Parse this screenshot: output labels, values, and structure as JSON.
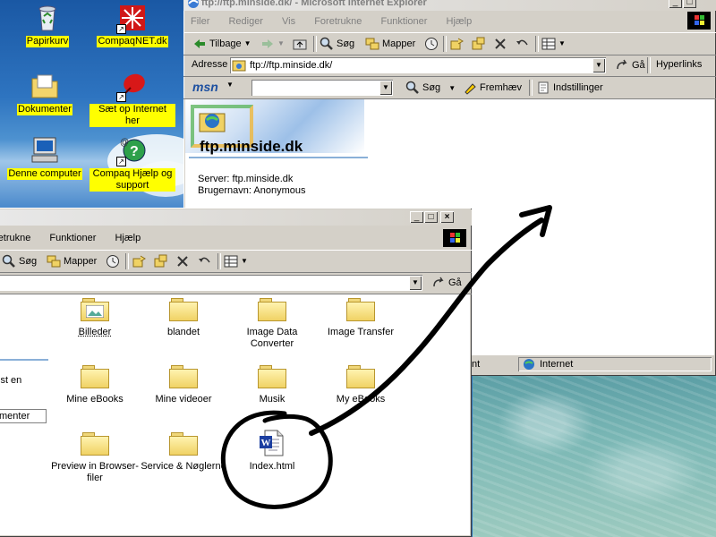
{
  "desktop": {
    "icons": [
      {
        "label": "Papirkurv"
      },
      {
        "label": "CompaqNET.dk"
      },
      {
        "label": "Dokumenter"
      },
      {
        "label": "Sæt op Internet her"
      },
      {
        "label": "Denne computer"
      },
      {
        "label": "Compaq Hjælp og support"
      }
    ]
  },
  "ie": {
    "title": "ftp://ftp.minside.dk/ - Microsoft Internet Explorer",
    "menu": [
      "Filer",
      "Rediger",
      "Vis",
      "Foretrukne",
      "Funktioner",
      "Hjælp"
    ],
    "toolbar": {
      "back": "Tilbage",
      "search": "Søg",
      "folders": "Mapper"
    },
    "address_label": "Adresse",
    "address_value": "ftp://ftp.minside.dk/",
    "go_label": "Gå",
    "links_label": "Hyperlinks",
    "msn_logo": "msn",
    "msn_search": "Søg",
    "msn_highlight": "Fremhæv",
    "msn_settings": "Indstillinger",
    "page_heading": "ftp.minside.dk",
    "server_line": "Server: ftp.minside.dk",
    "user_line": "Brugernavn: Anonymous",
    "status_left": "nt",
    "status_zone": "Internet"
  },
  "explorer": {
    "menu": [
      "retrukne",
      "Funktioner",
      "Hjælp"
    ],
    "toolbar": {
      "search": "Søg",
      "folders": "Mapper"
    },
    "go_label": "Gå",
    "left_text_1": "ist en",
    "left_text_2": "menter",
    "items": [
      {
        "label": "Billeder",
        "kind": "folder-special"
      },
      {
        "label": "blandet",
        "kind": "folder"
      },
      {
        "label": "Image Data Converter",
        "kind": "folder"
      },
      {
        "label": "Image Transfer",
        "kind": "folder"
      },
      {
        "label": "Mine eBooks",
        "kind": "folder"
      },
      {
        "label": "Mine videoer",
        "kind": "folder"
      },
      {
        "label": "Musik",
        "kind": "folder"
      },
      {
        "label": "My eBooks",
        "kind": "folder"
      },
      {
        "label": "Preview in Browser-filer",
        "kind": "folder"
      },
      {
        "label": "Service & Nøglerne",
        "kind": "folder"
      },
      {
        "label": "Index.html",
        "kind": "word-doc"
      }
    ]
  },
  "colors": {
    "desktop_label_bg": "#ffff00",
    "title_inactive_text": "#808080",
    "window_face": "#d4d0c8"
  }
}
